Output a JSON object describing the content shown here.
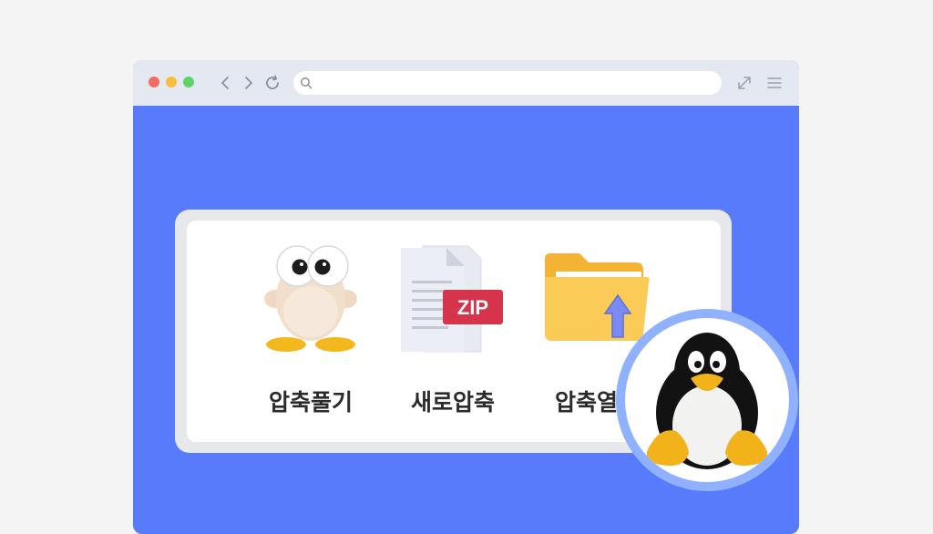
{
  "browser": {
    "url": "",
    "window_controls": [
      "close",
      "minimize",
      "maximize"
    ],
    "nav_icons": [
      "back-icon",
      "forward-icon",
      "reload-icon"
    ],
    "right_icons": [
      "expand-icon",
      "menu-icon"
    ]
  },
  "actions": [
    {
      "label": "압축풀기",
      "icon": "extract-icon"
    },
    {
      "label": "새로압축",
      "icon": "zip-file-icon"
    },
    {
      "label": "압축열기",
      "icon": "open-folder-icon"
    }
  ],
  "zip_badge": "ZIP",
  "colors": {
    "background": "#587bfc",
    "titlebar": "#e3e8f1",
    "badge_ring": "#8fb1ff"
  }
}
